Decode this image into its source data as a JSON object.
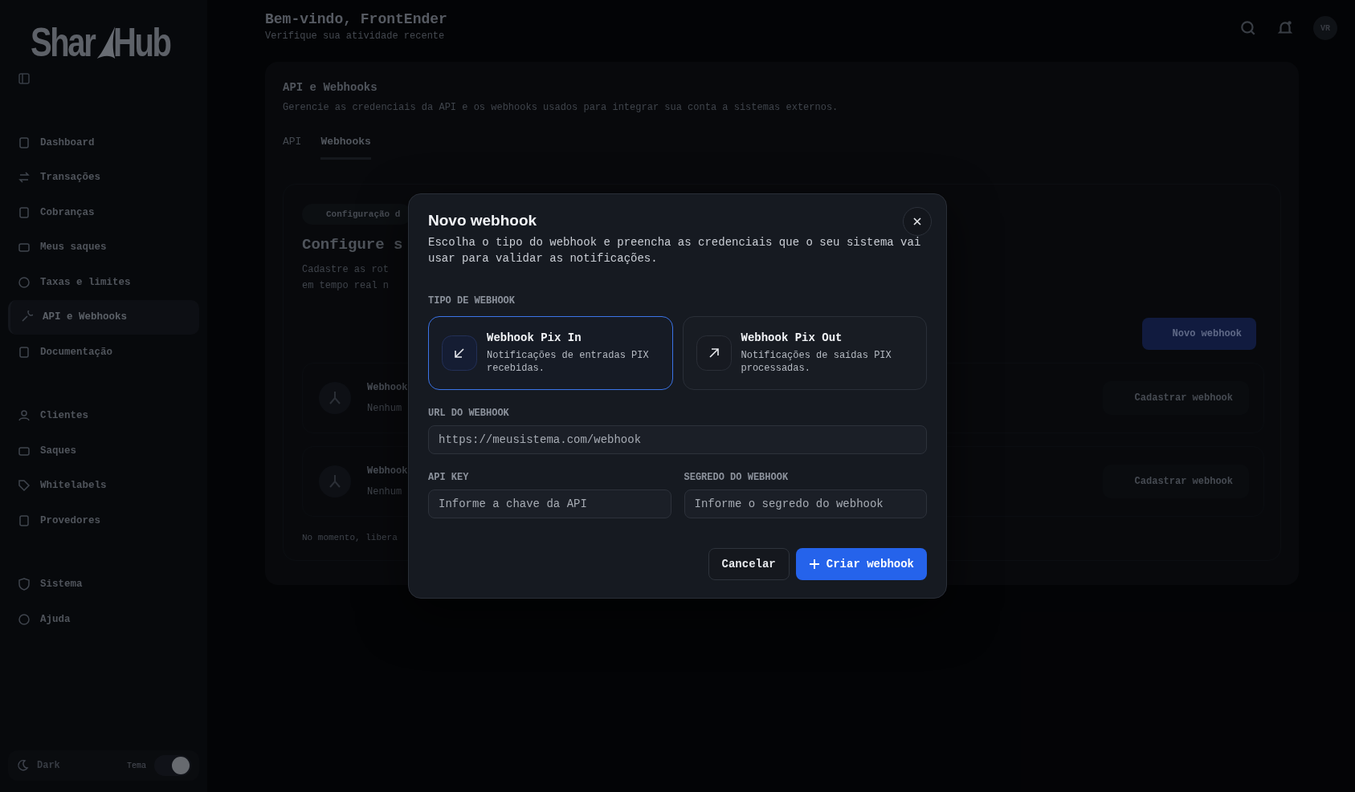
{
  "sidebar": {
    "logo_left": "Shar",
    "logo_right": "Hub",
    "groups": [
      {
        "items": [
          {
            "label": "Dashboard",
            "selected": false
          },
          {
            "label": "Transações",
            "selected": false
          },
          {
            "label": "Cobranças",
            "selected": false
          },
          {
            "label": "Meus saques",
            "selected": false
          },
          {
            "label": "Taxas e limites",
            "selected": false
          },
          {
            "label": "API e Webhooks",
            "selected": true
          },
          {
            "label": "Documentação",
            "selected": false
          }
        ]
      },
      {
        "items": [
          {
            "label": "Clientes",
            "selected": false
          },
          {
            "label": "Saques",
            "selected": false
          },
          {
            "label": "Whitelabels",
            "selected": false
          },
          {
            "label": "Provedores",
            "selected": false
          }
        ]
      },
      {
        "items": [
          {
            "label": "Sistema",
            "selected": false
          },
          {
            "label": "Ajuda",
            "selected": false
          }
        ]
      }
    ],
    "theme": {
      "label": "Dark",
      "caption": "Tema",
      "on": true
    }
  },
  "header": {
    "title": "Bem-vindo, FrontEnder",
    "subtitle": "Verifique sua atividade recente",
    "avatar": "VR"
  },
  "card": {
    "title": "API e Webhooks",
    "description": "Gerencie as credenciais da API e os webhooks usados para integrar sua conta a sistemas externos.",
    "tabs": [
      {
        "label": "API",
        "selected": false
      },
      {
        "label": "Webhooks",
        "selected": true
      }
    ],
    "badge": "Configuração d",
    "heading": "Configure s",
    "text_lines": [
      "Cadastre as rot",
      "em tempo real n"
    ],
    "new_button": "Novo webhook",
    "rows": [
      {
        "title": "Webhook",
        "status": "Nenhum",
        "action": "Cadastrar webhook"
      },
      {
        "title": "Webhook",
        "status": "Nenhum",
        "action": "Cadastrar webhook"
      }
    ],
    "footer": "No momento, libera"
  },
  "modal": {
    "title": "Novo webhook",
    "description": "Escolha o tipo do webhook e preencha as credenciais que o seu sistema vai usar para validar as notificações.",
    "type_label": "TIPO DE WEBHOOK",
    "types": [
      {
        "kind": "in",
        "title": "Webhook Pix In",
        "description": "Notificações de entradas PIX recebidas.",
        "selected": true
      },
      {
        "kind": "out",
        "title": "Webhook Pix Out",
        "description": "Notificações de saídas PIX processadas.",
        "selected": false
      }
    ],
    "url": {
      "label": "URL DO WEBHOOK",
      "placeholder": "https://meusistema.com/webhook"
    },
    "api_key": {
      "label": "API KEY",
      "placeholder": "Informe a chave da API"
    },
    "secret": {
      "label": "SEGREDO DO WEBHOOK",
      "placeholder": "Informe o segredo do webhook"
    },
    "cancel": "Cancelar",
    "submit": "Criar webhook"
  }
}
